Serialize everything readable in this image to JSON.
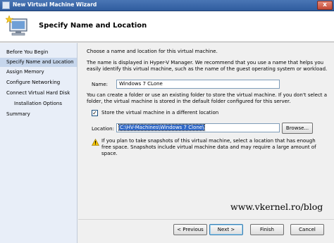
{
  "window": {
    "title": "New Virtual Machine Wizard",
    "close_glyph": "x"
  },
  "header": {
    "title": "Specify Name and Location",
    "icon": "wizard-vm-icon"
  },
  "nav": {
    "items": [
      {
        "label": "Before You Begin"
      },
      {
        "label": "Specify Name and Location"
      },
      {
        "label": "Assign Memory"
      },
      {
        "label": "Configure Networking"
      },
      {
        "label": "Connect Virtual Hard Disk"
      },
      {
        "label": "Installation Options"
      },
      {
        "label": "Summary"
      }
    ]
  },
  "content": {
    "intro": "Choose a name and location for this virtual machine.",
    "name_help": "The name is displayed in Hyper-V Manager. We recommend that you use a name that helps you easily identify this virtual machine, such as the name of the guest operating system or workload.",
    "name_label": "Name:",
    "name_value": "Windows 7 CLone",
    "location_help": "You can create a folder or use an existing folder to store the virtual machine. If you don't select a folder, the virtual machine is stored in the default folder configured for this server.",
    "store_checkbox_label": "Store the virtual machine in a different location",
    "store_checked": true,
    "location_label": "Location:",
    "location_value": "C:\\HV-Machines\\Windows 7 Clone\\",
    "browse_label": "Browse...",
    "warning_text": "If you plan to take snapshots of this virtual machine, select a location that has enough free space. Snapshots include virtual machine data and may require a large amount of space."
  },
  "buttons": {
    "previous": "< Previous",
    "next": "Next >",
    "finish": "Finish",
    "cancel": "Cancel"
  },
  "watermark": "www.vkernel.ro/blog",
  "colors": {
    "nav_bg": "#e8eef8",
    "nav_active": "#c6d6ec",
    "selection": "#3169c6",
    "titlebar": "#2f5c9e",
    "warning": "#f2c200"
  }
}
